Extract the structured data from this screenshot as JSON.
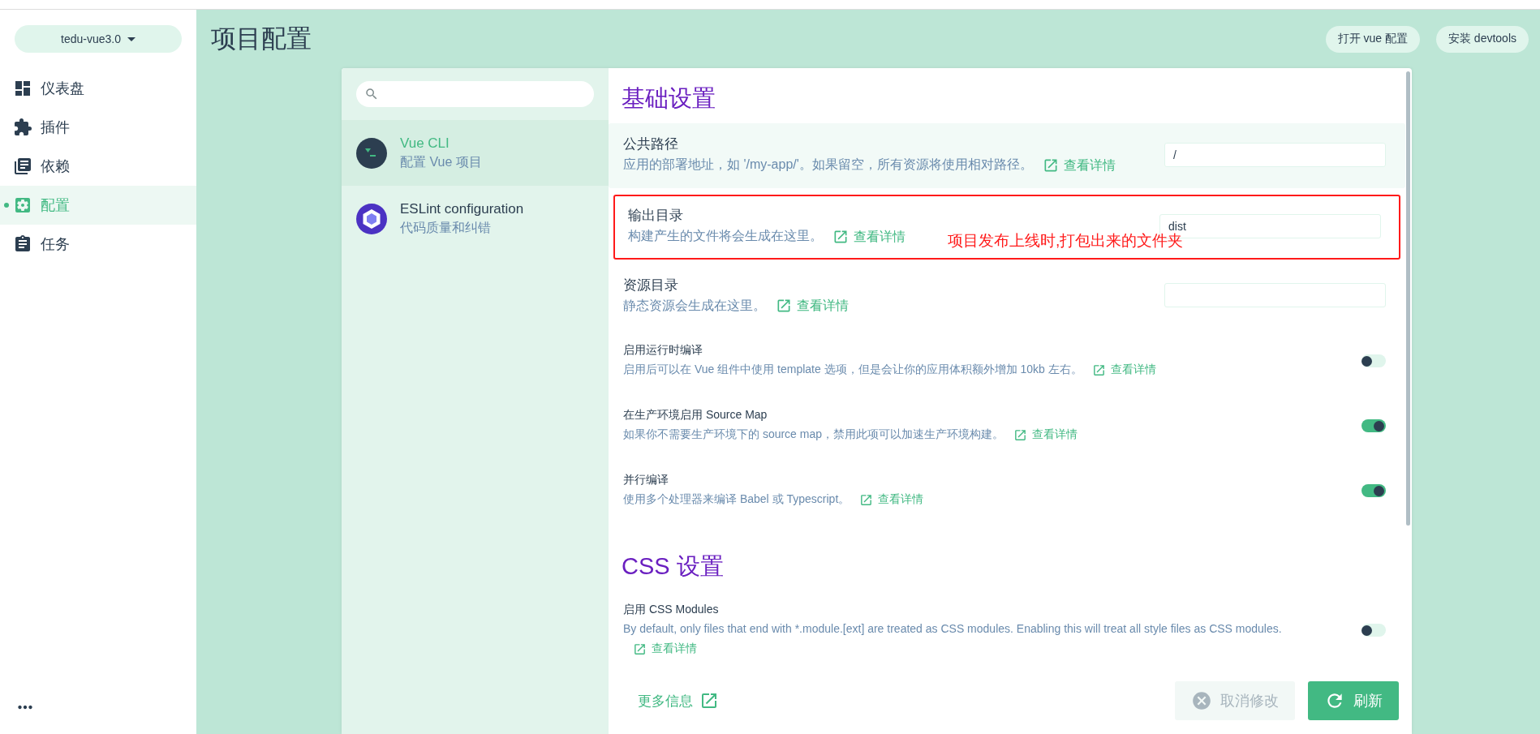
{
  "sidebar": {
    "project": "tedu-vue3.0",
    "items": [
      {
        "label": "仪表盘",
        "selected": false
      },
      {
        "label": "插件",
        "selected": false
      },
      {
        "label": "依赖",
        "selected": false
      },
      {
        "label": "配置",
        "selected": true
      },
      {
        "label": "任务",
        "selected": false
      }
    ]
  },
  "page_title": "项目配置",
  "header_buttons": [
    "打开 vue 配置",
    "安装 devtools"
  ],
  "config_list": [
    {
      "title": "Vue CLI",
      "subtitle": "配置 Vue 项目",
      "selected": true
    },
    {
      "title": "ESLint configuration",
      "subtitle": "代码质量和纠错",
      "selected": false
    }
  ],
  "sections": [
    {
      "title": "基础设置",
      "settings": [
        {
          "kind": "input",
          "label": "公共路径",
          "description": "应用的部署地址，如 '/my-app/'。如果留空，所有资源将使用相对路径。",
          "link": "查看详情",
          "value": "/",
          "highlighted": true
        },
        {
          "kind": "input",
          "label": "输出目录",
          "description": "构建产生的文件将会生成在这里。",
          "link": "查看详情",
          "value": "dist",
          "highlighted": false,
          "annotation": "项目发布上线时,打包出来的文件夹"
        },
        {
          "kind": "input",
          "label": "资源目录",
          "description": "静态资源会生成在这里。",
          "link": "查看详情",
          "highlighted": false
        },
        {
          "kind": "switch",
          "label": "启用运行时编译",
          "description": "启用后可以在 Vue 组件中使用 template 选项，但是会让你的应用体积额外增加 10kb 左右。",
          "link": "查看详情",
          "on": false,
          "highlighted": false
        },
        {
          "kind": "switch",
          "label": "在生产环境启用 Source Map",
          "description": "如果你不需要生产环境下的 source map，禁用此项可以加速生产环境构建。",
          "link": "查看详情",
          "on": true,
          "highlighted": false
        },
        {
          "kind": "switch",
          "label": "并行编译",
          "description": "使用多个处理器来编译 Babel 或 Typescript。",
          "link": "查看详情",
          "on": true,
          "highlighted": false
        }
      ]
    },
    {
      "title": "CSS 设置",
      "settings": [
        {
          "kind": "switch",
          "label": "启用 CSS Modules",
          "description": "By default, only files that end with *.module.[ext] are treated as CSS modules. Enabling this will treat all style files as CSS modules.",
          "link": "查看详情",
          "on": false,
          "highlighted": false
        }
      ]
    }
  ],
  "footer": {
    "more_info": "更多信息",
    "cancel": {
      "label": "取消修改",
      "disabled": true
    },
    "refresh": "刷新"
  }
}
